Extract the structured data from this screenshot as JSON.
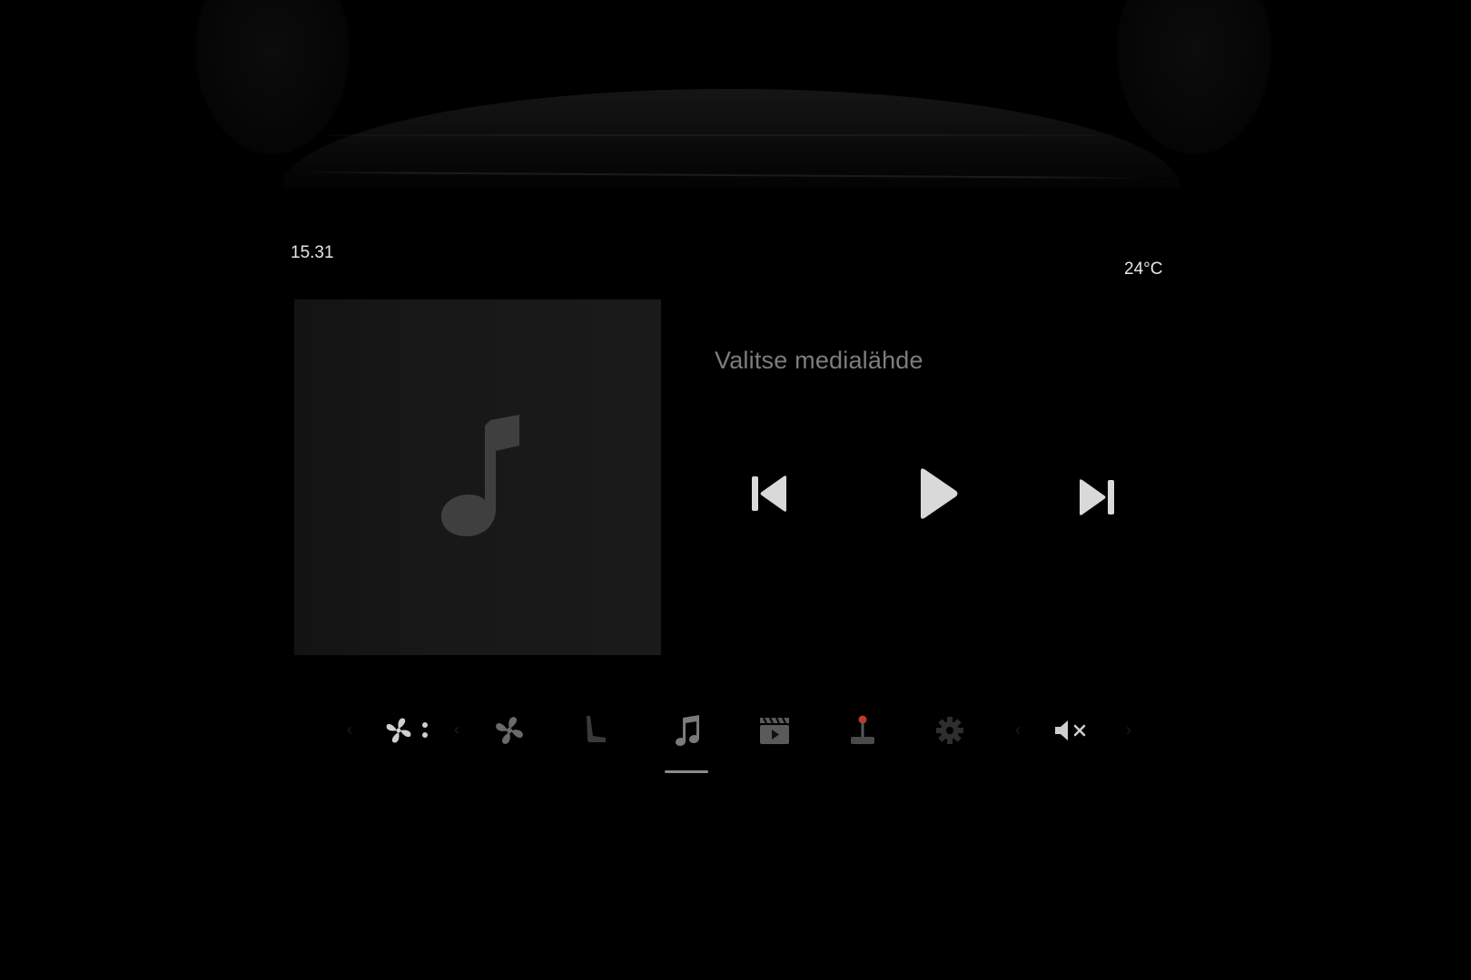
{
  "status": {
    "time": "15.31",
    "temperature": "24°C"
  },
  "media": {
    "source_prompt": "Valitse medialähde",
    "album_art_icon": "music-note-icon",
    "controls": [
      {
        "name": "previous-track",
        "icon": "skip-previous-icon"
      },
      {
        "name": "play",
        "icon": "play-icon"
      },
      {
        "name": "next-track",
        "icon": "skip-next-icon"
      }
    ]
  },
  "dock": {
    "items": [
      {
        "name": "climate",
        "icon": "fan-settings-icon"
      },
      {
        "name": "fan",
        "icon": "fan-icon"
      },
      {
        "name": "seat",
        "icon": "seat-icon"
      },
      {
        "name": "music",
        "icon": "music-note-icon",
        "active": true
      },
      {
        "name": "video",
        "icon": "video-clapper-icon"
      },
      {
        "name": "games",
        "icon": "joystick-icon"
      },
      {
        "name": "settings",
        "icon": "gear-icon"
      },
      {
        "name": "volume",
        "icon": "volume-muted-icon"
      }
    ]
  },
  "colors": {
    "background": "#000000",
    "text_primary": "#e6e6e6",
    "text_secondary": "#7d7d7d",
    "control_fill": "#d9d9d9",
    "joystick_accent": "#c0392b"
  }
}
